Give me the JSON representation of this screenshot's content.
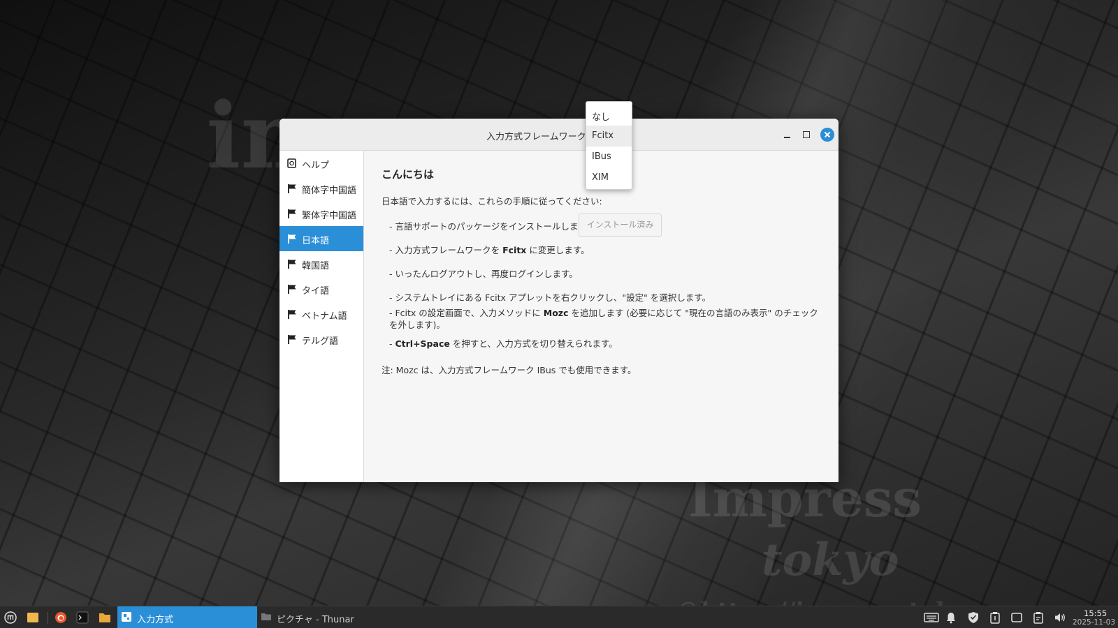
{
  "desktop": {
    "watermark_1": "im",
    "watermark_2": "Impress",
    "watermark_3": "tokyo",
    "watermark_4": "©https://impress.tokyo"
  },
  "window": {
    "title_label": "入力方式フレームワーク:",
    "sidebar": {
      "items": [
        {
          "label": "ヘルプ",
          "icon": "help-icon"
        },
        {
          "label": "簡体字中国語",
          "icon": "flag-icon"
        },
        {
          "label": "繁体字中国語",
          "icon": "flag-icon"
        },
        {
          "label": "日本語",
          "icon": "flag-icon",
          "selected": true
        },
        {
          "label": "韓国語",
          "icon": "flag-icon"
        },
        {
          "label": "タイ語",
          "icon": "flag-icon"
        },
        {
          "label": "ベトナム語",
          "icon": "flag-icon"
        },
        {
          "label": "テルグ語",
          "icon": "flag-icon"
        }
      ]
    },
    "content": {
      "heading": "こんにちは",
      "intro": "日本語で入力するには、これらの手順に従ってください:",
      "step1": "- 言語サポートのパッケージをインストールします:",
      "install_button": "インストール済み",
      "step2_pre": "- 入力方式フレームワークを ",
      "step2_bold": "Fcitx",
      "step2_post": " に変更します。",
      "step3": "- いったんログアウトし、再度ログインします。",
      "step4": "- システムトレイにある Fcitx アプレットを右クリックし、\"設定\" を選択します。",
      "step5_pre": "- Fcitx の設定画面で、入力メソッドに ",
      "step5_bold": "Mozc",
      "step5_post": " を追加します (必要に応じて \"現在の言語のみ表示\" のチェックを外します)。",
      "step6_pre": "- ",
      "step6_bold": "Ctrl+Space",
      "step6_post": " を押すと、入力方式を切り替えられます。",
      "note": "注: Mozc は、入力方式フレームワーク IBus でも使用できます。"
    }
  },
  "dropdown": {
    "options": [
      "なし",
      "Fcitx",
      "IBus",
      "XIM"
    ],
    "highlighted": "Fcitx"
  },
  "taskbar": {
    "tasks": [
      {
        "label": "入力方式",
        "active": true
      },
      {
        "label": "ピクチャ - Thunar",
        "active": false
      }
    ],
    "clock_time": "15:55",
    "clock_date": "2025-11-03"
  },
  "colors": {
    "accent": "#2b8fd8",
    "window_bg": "#f6f6f6",
    "taskbar_bg": "#2a2a2a"
  }
}
